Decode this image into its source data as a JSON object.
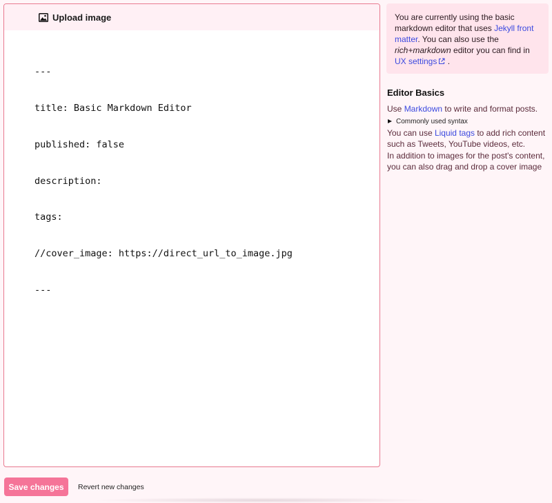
{
  "editor": {
    "toolbar": {
      "upload_label": "Upload image",
      "upload_icon": "image-icon"
    },
    "lines": [
      "---",
      "title: Basic Markdown Editor",
      "published: false",
      "description:",
      "tags:",
      "//cover_image: https://direct_url_to_image.jpg",
      "---"
    ]
  },
  "notice": {
    "text_1": "You are currently using the basic markdown editor that uses ",
    "link_1": "Jekyll front matter",
    "text_2": ". You can also use the ",
    "em": "rich+markdown",
    "text_3": " editor you can find in ",
    "link_2": "UX settings",
    "link_2_icon": "external-link-icon",
    "text_4": " ."
  },
  "basics": {
    "title": "Editor Basics",
    "p1_a": "Use ",
    "p1_link": "Markdown",
    "p1_b": " to write and format posts.",
    "syntax_label": "Commonly used syntax",
    "p2_a": "You can use ",
    "p2_link": "Liquid tags",
    "p2_b": " to add rich content such as Tweets, YouTube videos, etc.",
    "p3": "In addition to images for the post's content, you can also drag and drop a cover image"
  },
  "actions": {
    "save_label": "Save changes",
    "revert_label": "Revert new changes"
  },
  "colors": {
    "accent": "#f57498",
    "border": "#e8798f",
    "link": "#3b49df",
    "background": "#fff5f8",
    "notice_bg": "#ffe4ec"
  }
}
